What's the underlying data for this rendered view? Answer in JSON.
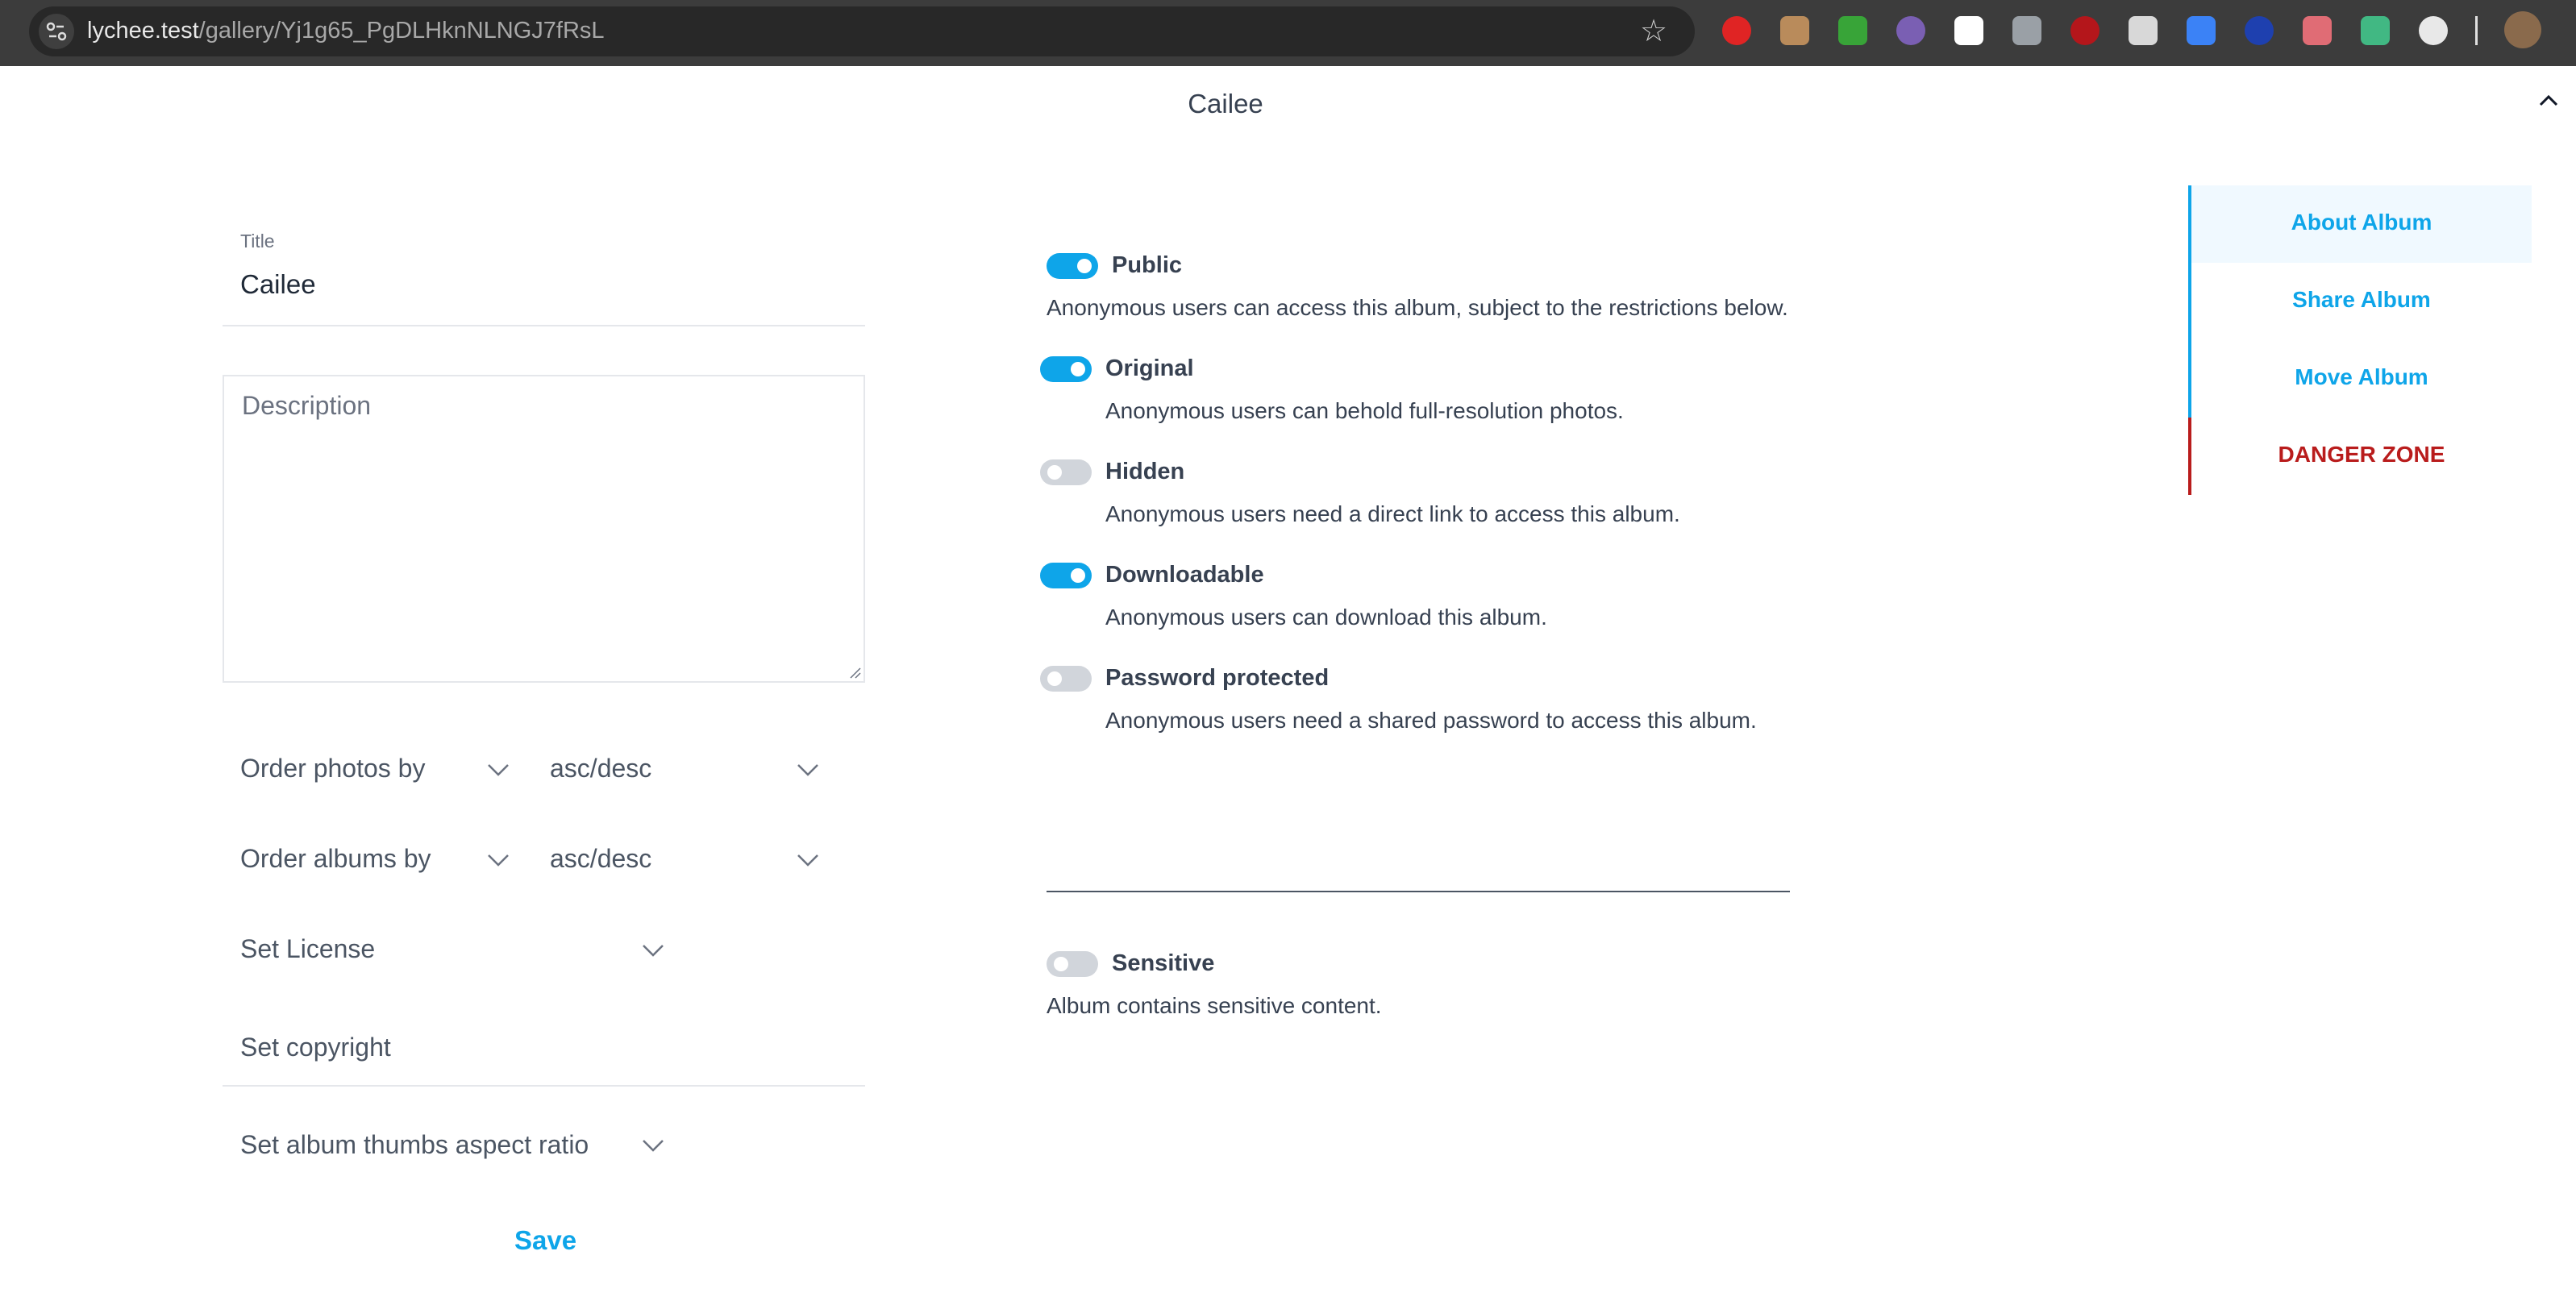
{
  "browser": {
    "url_host": "lychee.test",
    "url_path": "/gallery/Yj1g65_PgDLHknNLNGJ7fRsL",
    "extensions": [
      {
        "name": "hand-extension-icon",
        "color": "#e02424"
      },
      {
        "name": "mask-extension-icon",
        "color": "#b98b5b"
      },
      {
        "name": "green-extension-icon",
        "color": "#38a438"
      },
      {
        "name": "fox-extension-icon",
        "color": "#7a5fb3"
      },
      {
        "name": "record-extension-icon",
        "color": "#ffffff"
      },
      {
        "name": "joystick-extension-icon",
        "color": "#9aa0a6"
      },
      {
        "name": "ublock-extension-icon",
        "color": "#b4161b"
      },
      {
        "name": "shield-extension-icon",
        "color": "#d8d8d8"
      },
      {
        "name": "screen-extension-icon",
        "color": "#3b82f6"
      },
      {
        "name": "globe-extension-icon",
        "color": "#1e40af"
      },
      {
        "name": "moon-extension-icon",
        "color": "#e06c75"
      },
      {
        "name": "vue-extension-icon",
        "color": "#41b883"
      },
      {
        "name": "puzzle-extension-icon",
        "color": "#e8e8e8"
      }
    ]
  },
  "header": {
    "album_title": "Cailee"
  },
  "form": {
    "title_label": "Title",
    "title_value": "Cailee",
    "description_placeholder": "Description",
    "order_photos_by": "Order photos by",
    "order_photos_dir": "asc/desc",
    "order_albums_by": "Order albums by",
    "order_albums_dir": "asc/desc",
    "license": "Set License",
    "copyright_placeholder": "Set copyright",
    "aspect_ratio": "Set album thumbs aspect ratio",
    "save_label": "Save"
  },
  "visibility": {
    "public_label": "Public",
    "public_desc": "Anonymous users can access this album, subject to the restrictions below.",
    "options": [
      {
        "label": "Original",
        "desc": "Anonymous users can behold full-resolution photos.",
        "enabled": true
      },
      {
        "label": "Hidden",
        "desc": "Anonymous users need a direct link to access this album.",
        "enabled": false
      },
      {
        "label": "Downloadable",
        "desc": "Anonymous users can download this album.",
        "enabled": true
      },
      {
        "label": "Password protected",
        "desc": "Anonymous users need a shared password to access this album.",
        "enabled": false
      }
    ],
    "sensitive_label": "Sensitive",
    "sensitive_desc": "Album contains sensitive content."
  },
  "nav": {
    "items": [
      "About Album",
      "Share Album",
      "Move Album",
      "DANGER ZONE"
    ],
    "active": "About Album"
  },
  "colors": {
    "accent": "#0ea5e9",
    "danger": "#b91c1c"
  }
}
